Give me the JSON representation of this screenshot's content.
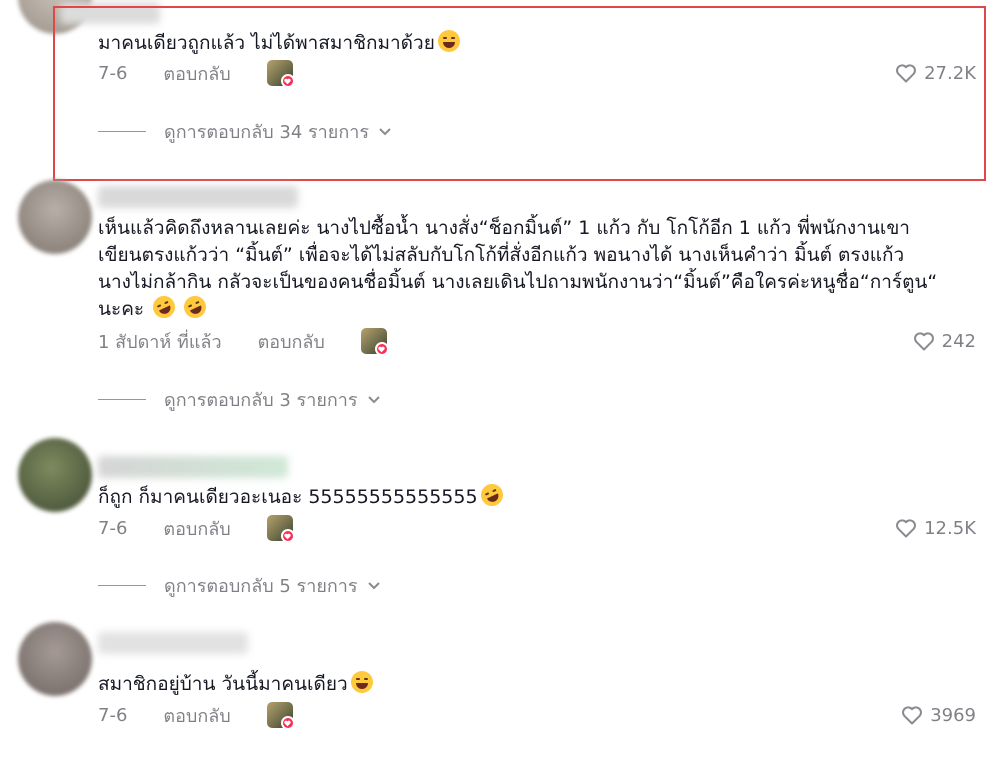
{
  "colors": {
    "accent": "#fe2c55",
    "highlight": "#e04848",
    "muted": "#8a8b91"
  },
  "comments": [
    {
      "text": "มาคนเดียวถูกแล้ว ไม่ได้พาสมาชิกมาด้วย",
      "date": "7-6",
      "reply_label": "ตอบกลับ",
      "likes": "27.2K",
      "view_replies": "ดูการตอบกลับ 34 รายการ"
    },
    {
      "lines": [
        "เห็นแล้วคิดถึงหลานเลยค่ะ นางไปซื้อน้ำ นางสั่ง“ช็อกมิ้นต์” 1 แก้ว กับ โกโก้อีก 1 แก้ว พี่พนักงานเขา",
        "เขียนตรงแก้วว่า “มิ้นต์” เพื่อจะได้ไม่สลับกับโกโก้ที่สั่งอีกแก้ว พอนางได้ นางเห็นคำว่า มิ้นต์ ตรงแก้ว",
        "นางไม่กล้ากิน กลัวจะเป็นของคนชื่อมิ้นต์ นางเลยเดินไปถามพนักงานว่า“มิ้นต์”คือใครค่ะหนูชื่อ“การ์ตูน“",
        "นะคะ"
      ],
      "date": "1 สัปดาห์ ที่แล้ว",
      "reply_label": "ตอบกลับ",
      "likes": "242",
      "view_replies": "ดูการตอบกลับ 3 รายการ"
    },
    {
      "text": "ก็ถูก ก็มาคนเดียวอะเนอะ 55555555555555",
      "date": "7-6",
      "reply_label": "ตอบกลับ",
      "likes": "12.5K",
      "view_replies": "ดูการตอบกลับ 5 รายการ"
    },
    {
      "text": "สมาชิกอยู่บ้าน วันนี้มาคนเดียว",
      "date": "7-6",
      "reply_label": "ตอบกลับ",
      "likes": "3969"
    }
  ],
  "icons": {
    "like": "heart-outline-icon",
    "expand": "chevron-down-icon",
    "creator_badge": "heart-badge-icon",
    "emoji_laugh": "tears-of-joy-emoji",
    "emoji_rofl": "rolling-on-floor-laughing-emoji"
  }
}
